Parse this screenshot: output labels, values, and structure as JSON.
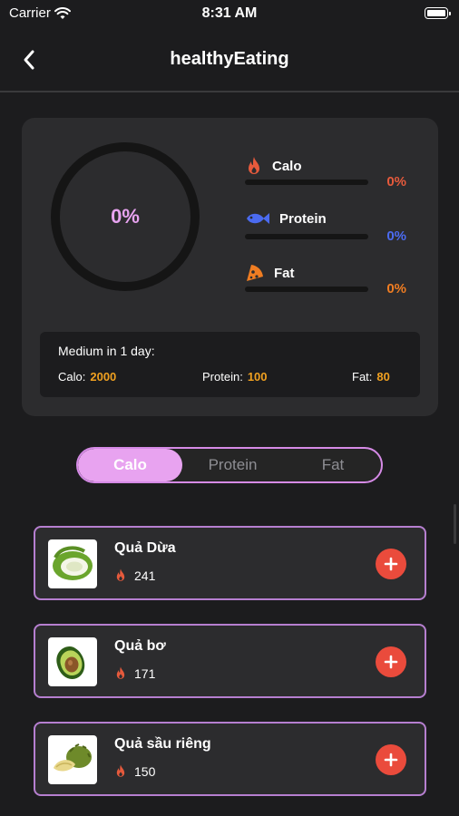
{
  "status": {
    "carrier": "Carrier",
    "time": "8:31 AM"
  },
  "nav": {
    "title": "healthyEating"
  },
  "summary": {
    "progress_label": "0%",
    "macros": [
      {
        "name": "Calo",
        "percent": "0%",
        "color": "#e65a3c",
        "icon": "flame-icon"
      },
      {
        "name": "Protein",
        "percent": "0%",
        "color": "#4b6bf0",
        "icon": "fish-icon"
      },
      {
        "name": "Fat",
        "percent": "0%",
        "color": "#f07d22",
        "icon": "pizza-icon"
      }
    ]
  },
  "medium": {
    "title": "Medium in 1 day:",
    "calo_label": "Calo:",
    "calo_value": "2000",
    "protein_label": "Protein:",
    "protein_value": "100",
    "fat_label": "Fat:",
    "fat_value": "80"
  },
  "tabs": [
    "Calo",
    "Protein",
    "Fat"
  ],
  "foods": [
    {
      "name": "Quả Dừa",
      "calories": "241",
      "image": "coconut"
    },
    {
      "name": "Quả bơ",
      "calories": "171",
      "image": "avocado"
    },
    {
      "name": "Quả sầu riêng",
      "calories": "150",
      "image": "durian"
    }
  ],
  "colors": {
    "accent": "#e8a3f0",
    "border": "#b67fd0",
    "add": "#ea4b3c",
    "value": "#f0a020"
  }
}
